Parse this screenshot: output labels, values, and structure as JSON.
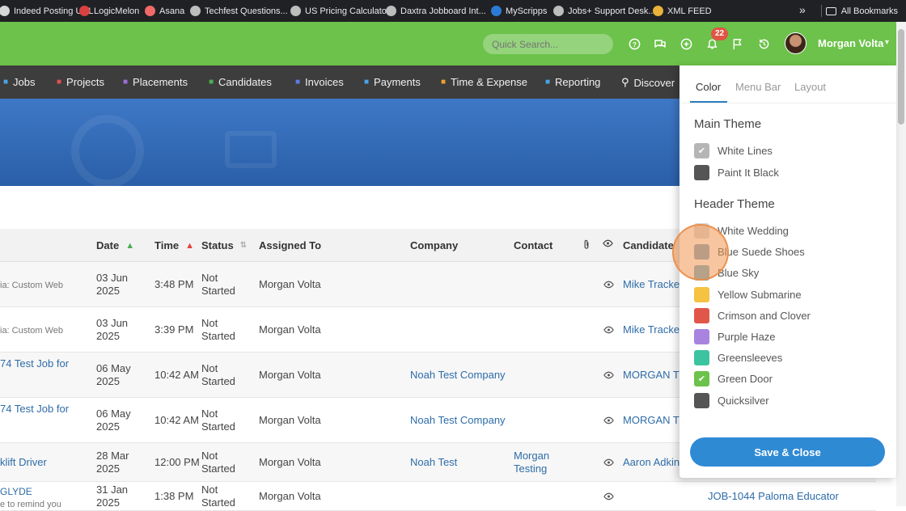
{
  "bookmarks": [
    {
      "label": "Indeed Posting URL",
      "icon": "indeed-icon",
      "color": "#d6d6d6"
    },
    {
      "label": "LogicMelon",
      "icon": "logicmelon-icon",
      "color": "#d94040"
    },
    {
      "label": "Asana",
      "icon": "asana-icon",
      "color": "#f06a6a"
    },
    {
      "label": "Techfest Questions...",
      "icon": "globe-icon",
      "color": "#bdbdbd"
    },
    {
      "label": "US Pricing Calculator",
      "icon": "globe-icon",
      "color": "#bdbdbd"
    },
    {
      "label": "Daxtra Jobboard Int...",
      "icon": "globe-icon",
      "color": "#bdbdbd"
    },
    {
      "label": "MyScripps",
      "icon": "myscripps-icon",
      "color": "#2b7bd6"
    },
    {
      "label": "Jobs+ Support Desk...",
      "icon": "globe-icon",
      "color": "#bdbdbd"
    },
    {
      "label": "XML FEED",
      "icon": "chrome-icon",
      "color": "#e9b23a"
    }
  ],
  "bookmarks_right": {
    "label": "All Bookmarks"
  },
  "header": {
    "search_placeholder": "Quick Search...",
    "notification_count": "22",
    "user_name": "Morgan Volta",
    "accent": "#6cc24a"
  },
  "nav": [
    {
      "label": "Jobs",
      "icon": "trophy-icon",
      "icon_color": "#4aa3e8"
    },
    {
      "label": "Projects",
      "icon": "checklist-icon",
      "icon_color": "#e05050"
    },
    {
      "label": "Placements",
      "icon": "briefcase-icon",
      "icon_color": "#9b6fd6"
    },
    {
      "label": "Candidates",
      "icon": "person-icon",
      "icon_color": "#4caf50"
    },
    {
      "label": "Invoices",
      "icon": "document-icon",
      "icon_color": "#5c7ce0"
    },
    {
      "label": "Payments",
      "icon": "coins-icon",
      "icon_color": "#4aa3e8"
    },
    {
      "label": "Time & Expense",
      "icon": "clock-icon",
      "icon_color": "#f0a030"
    },
    {
      "label": "Reporting",
      "icon": "bar-chart-icon",
      "icon_color": "#4aa3e8"
    },
    {
      "label": "Discover",
      "icon": "search-icon",
      "icon_color": "#ffffff"
    }
  ],
  "table": {
    "columns": [
      "Date",
      "Time",
      "Status",
      "Assigned To",
      "Company",
      "Contact",
      "Candidate"
    ],
    "rows": [
      {
        "title": "ia: Custom Web",
        "title_muted": true,
        "date": [
          "03 Jun",
          "2025"
        ],
        "time": "3:48 PM",
        "status": [
          "Not",
          "Started"
        ],
        "assigned": "Morgan Volta",
        "company": "",
        "contact": [],
        "candidate": "Mike Tracke"
      },
      {
        "title": "ia: Custom Web",
        "title_muted": true,
        "date": [
          "03 Jun",
          "2025"
        ],
        "time": "3:39 PM",
        "status": [
          "Not",
          "Started"
        ],
        "assigned": "Morgan Volta",
        "company": "",
        "contact": [],
        "candidate": "Mike Tracke"
      },
      {
        "title": "74 Test Job for",
        "title_muted": false,
        "date": [
          "06 May",
          "2025"
        ],
        "time": "10:42 AM",
        "status": [
          "Not",
          "Started"
        ],
        "assigned": "Morgan Volta",
        "company": "Noah Test Company",
        "contact": [],
        "candidate": "MORGAN TES"
      },
      {
        "title": "74 Test Job for",
        "title_muted": false,
        "date": [
          "06 May",
          "2025"
        ],
        "time": "10:42 AM",
        "status": [
          "Not",
          "Started"
        ],
        "assigned": "Morgan Volta",
        "company": "Noah Test Company",
        "contact": [],
        "candidate": "MORGAN TES"
      },
      {
        "title": "klift Driver",
        "title_muted": false,
        "date": [
          "28 Mar",
          "2025"
        ],
        "time": "12:00 PM",
        "status": [
          "Not",
          "Started"
        ],
        "assigned": "Morgan Volta",
        "company": "Noah Test",
        "contact": [
          "Morgan",
          "Testing"
        ],
        "candidate": "Aaron Adkin"
      },
      {
        "title": "GLYDE",
        "subtitle": "e to remind you",
        "title_muted": false,
        "date": [
          "31 Jan",
          "2025"
        ],
        "time": "1:38 PM",
        "status": [
          "Not",
          "Started"
        ],
        "assigned": "Morgan Volta",
        "company": "",
        "contact": [],
        "candidate": "JOB-1044 Paloma Educator"
      }
    ]
  },
  "panel": {
    "tabs": [
      "Color",
      "Menu Bar",
      "Layout"
    ],
    "active_tab": "Color",
    "main_theme_title": "Main Theme",
    "main_theme": [
      {
        "label": "White Lines",
        "color": "#b5b5b5",
        "checked": true
      },
      {
        "label": "Paint It Black",
        "color": "#555555",
        "checked": false
      }
    ],
    "header_theme_title": "Header Theme",
    "header_theme": [
      {
        "label": "White Wedding",
        "color": "#d9d9d9",
        "checked": false
      },
      {
        "label": "Blue Suede Shoes",
        "color": "#7ea4c8",
        "checked": false
      },
      {
        "label": "Blue Sky",
        "color": "#6fb0ce",
        "checked": false
      },
      {
        "label": "Yellow Submarine",
        "color": "#f5c242",
        "checked": false
      },
      {
        "label": "Crimson and Clover",
        "color": "#e0574a",
        "checked": false
      },
      {
        "label": "Purple Haze",
        "color": "#a883e0",
        "checked": false
      },
      {
        "label": "Greensleeves",
        "color": "#3cc4a0",
        "checked": false
      },
      {
        "label": "Green Door",
        "color": "#6cc24a",
        "checked": true
      },
      {
        "label": "Quicksilver",
        "color": "#555555",
        "checked": false
      }
    ],
    "save_label": "Save & Close"
  }
}
